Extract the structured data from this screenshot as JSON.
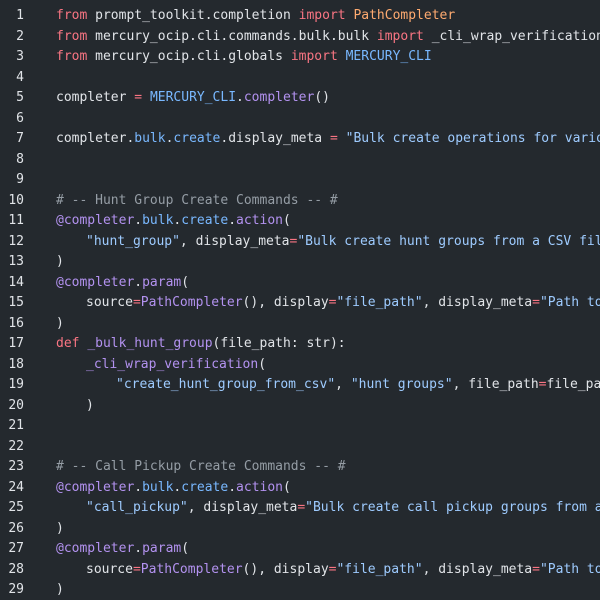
{
  "lines": [
    {
      "num": "1",
      "tokens": [
        [
          "kw",
          "from"
        ],
        [
          "var",
          " prompt_toolkit.completion "
        ],
        [
          "kw",
          "import"
        ],
        [
          "var",
          " "
        ],
        [
          "cls",
          "PathCompleter"
        ]
      ]
    },
    {
      "num": "2",
      "tokens": [
        [
          "kw",
          "from"
        ],
        [
          "var",
          " mercury_ocip.cli.commands.bulk.bulk "
        ],
        [
          "kw",
          "import"
        ],
        [
          "var",
          " _cli_wrap_verification"
        ]
      ]
    },
    {
      "num": "3",
      "tokens": [
        [
          "kw",
          "from"
        ],
        [
          "var",
          " mercury_ocip.cli.globals "
        ],
        [
          "kw",
          "import"
        ],
        [
          "var",
          " "
        ],
        [
          "const",
          "MERCURY_CLI"
        ]
      ]
    },
    {
      "num": "4",
      "tokens": []
    },
    {
      "num": "5",
      "tokens": [
        [
          "var",
          "completer "
        ],
        [
          "op",
          "="
        ],
        [
          "var",
          " "
        ],
        [
          "const",
          "MERCURY_CLI"
        ],
        [
          "var",
          "."
        ],
        [
          "fn",
          "completer"
        ],
        [
          "var",
          "()"
        ]
      ]
    },
    {
      "num": "6",
      "tokens": []
    },
    {
      "num": "7",
      "tokens": [
        [
          "var",
          "completer."
        ],
        [
          "const",
          "bulk"
        ],
        [
          "var",
          "."
        ],
        [
          "const",
          "create"
        ],
        [
          "var",
          "."
        ],
        [
          "var",
          "display_meta "
        ],
        [
          "op",
          "="
        ],
        [
          "var",
          " "
        ],
        [
          "str",
          "\"Bulk create operations for various e"
        ]
      ]
    },
    {
      "num": "8",
      "tokens": []
    },
    {
      "num": "9",
      "tokens": []
    },
    {
      "num": "10",
      "tokens": [
        [
          "cmt",
          "# -- Hunt Group Create Commands -- #"
        ]
      ]
    },
    {
      "num": "11",
      "tokens": [
        [
          "fn",
          "@completer"
        ],
        [
          "var",
          "."
        ],
        [
          "const",
          "bulk"
        ],
        [
          "var",
          "."
        ],
        [
          "const",
          "create"
        ],
        [
          "var",
          "."
        ],
        [
          "fn",
          "action"
        ],
        [
          "var",
          "("
        ]
      ]
    },
    {
      "num": "12",
      "indent": 1,
      "tokens": [
        [
          "str",
          "\"hunt_group\""
        ],
        [
          "var",
          ", display_meta"
        ],
        [
          "op",
          "="
        ],
        [
          "str",
          "\"Bulk create hunt groups from a CSV file\""
        ]
      ]
    },
    {
      "num": "13",
      "tokens": [
        [
          "var",
          ")"
        ]
      ]
    },
    {
      "num": "14",
      "tokens": [
        [
          "fn",
          "@completer"
        ],
        [
          "var",
          "."
        ],
        [
          "fn",
          "param"
        ],
        [
          "var",
          "("
        ]
      ]
    },
    {
      "num": "15",
      "indent": 1,
      "tokens": [
        [
          "var",
          "source"
        ],
        [
          "op",
          "="
        ],
        [
          "fn",
          "PathCompleter"
        ],
        [
          "var",
          "(), display"
        ],
        [
          "op",
          "="
        ],
        [
          "str",
          "\"file_path\""
        ],
        [
          "var",
          ", display_meta"
        ],
        [
          "op",
          "="
        ],
        [
          "str",
          "\"Path to CSV"
        ]
      ]
    },
    {
      "num": "16",
      "tokens": [
        [
          "var",
          ")"
        ]
      ]
    },
    {
      "num": "17",
      "tokens": [
        [
          "kw",
          "def"
        ],
        [
          "var",
          " "
        ],
        [
          "fn",
          "_bulk_hunt_group"
        ],
        [
          "var",
          "(file_path: str):"
        ]
      ]
    },
    {
      "num": "18",
      "indent": 1,
      "tokens": [
        [
          "fn",
          "_cli_wrap_verification"
        ],
        [
          "var",
          "("
        ]
      ]
    },
    {
      "num": "19",
      "indent": 2,
      "tokens": [
        [
          "str",
          "\"create_hunt_group_from_csv\""
        ],
        [
          "var",
          ", "
        ],
        [
          "str",
          "\"hunt groups\""
        ],
        [
          "var",
          ", file_path"
        ],
        [
          "op",
          "="
        ],
        [
          "var",
          "file_path"
        ]
      ]
    },
    {
      "num": "20",
      "indent": 1,
      "tokens": [
        [
          "var",
          ")"
        ]
      ]
    },
    {
      "num": "21",
      "tokens": []
    },
    {
      "num": "22",
      "tokens": []
    },
    {
      "num": "23",
      "tokens": [
        [
          "cmt",
          "# -- Call Pickup Create Commands -- #"
        ]
      ]
    },
    {
      "num": "24",
      "tokens": [
        [
          "fn",
          "@completer"
        ],
        [
          "var",
          "."
        ],
        [
          "const",
          "bulk"
        ],
        [
          "var",
          "."
        ],
        [
          "const",
          "create"
        ],
        [
          "var",
          "."
        ],
        [
          "fn",
          "action"
        ],
        [
          "var",
          "("
        ]
      ]
    },
    {
      "num": "25",
      "indent": 1,
      "tokens": [
        [
          "str",
          "\"call_pickup\""
        ],
        [
          "var",
          ", display_meta"
        ],
        [
          "op",
          "="
        ],
        [
          "str",
          "\"Bulk create call pickup groups from a CSV"
        ]
      ]
    },
    {
      "num": "26",
      "tokens": [
        [
          "var",
          ")"
        ]
      ]
    },
    {
      "num": "27",
      "tokens": [
        [
          "fn",
          "@completer"
        ],
        [
          "var",
          "."
        ],
        [
          "fn",
          "param"
        ],
        [
          "var",
          "("
        ]
      ]
    },
    {
      "num": "28",
      "indent": 1,
      "tokens": [
        [
          "var",
          "source"
        ],
        [
          "op",
          "="
        ],
        [
          "fn",
          "PathCompleter"
        ],
        [
          "var",
          "(), display"
        ],
        [
          "op",
          "="
        ],
        [
          "str",
          "\"file_path\""
        ],
        [
          "var",
          ", display_meta"
        ],
        [
          "op",
          "="
        ],
        [
          "str",
          "\"Path to CSV"
        ]
      ]
    },
    {
      "num": "29",
      "tokens": [
        [
          "var",
          ")"
        ]
      ]
    }
  ]
}
